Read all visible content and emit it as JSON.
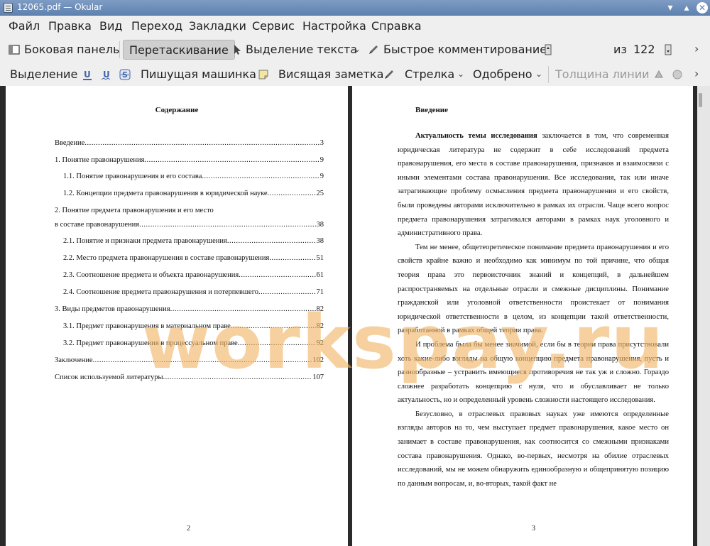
{
  "window": {
    "title": "12065.pdf — Okular"
  },
  "menubar": [
    "Файл",
    "Правка",
    "Вид",
    "Переход",
    "Закладки",
    "Сервис",
    "Настройка",
    "Справка"
  ],
  "toolbar1": {
    "sidebar_label": "Боковая панель",
    "drag_label": "Перетаскивание",
    "text_select_label": "Выделение текста",
    "quick_comment_label": "Быстрое комментирование",
    "page_current": "2",
    "page_of_label": "из",
    "page_total": "122"
  },
  "toolbar2": {
    "selection_label": "Выделение",
    "typewriter_label": "Пишущая машинка",
    "note_label": "Висящая заметка",
    "arrow_label": "Стрелка",
    "stamp_label": "Одобрено",
    "line_width_label": "Толщина линии"
  },
  "left_page": {
    "heading": "Содержание",
    "toc": [
      {
        "label": "Введение",
        "page": "3"
      },
      {
        "label": "1. Понятие правонарушения",
        "page": "9"
      },
      {
        "label": "1.1. Понятие правонарушения и его состава",
        "page": "9"
      },
      {
        "label": "1.2. Концепции предмета правонарушения в юридической науке",
        "page": "25"
      },
      {
        "label": "2. Понятие предмета правонарушения и его место",
        "page": ""
      },
      {
        "label": "в составе правонарушения",
        "page": "38"
      },
      {
        "label": "2.1. Понятие и признаки предмета правонарушения",
        "page": "38"
      },
      {
        "label": "2.2. Место предмета правонарушения в составе правонарушения",
        "page": "51"
      },
      {
        "label": "2.3. Соотношение предмета и объекта правонарушения",
        "page": "61"
      },
      {
        "label": "2.4. Соотношение предмета правонарушения и потерпевшего",
        "page": "71"
      },
      {
        "label": "3. Виды предметов правонарушения",
        "page": "82"
      },
      {
        "label": "3.1. Предмет правонарушения в материальном праве",
        "page": "82"
      },
      {
        "label": "3.2. Предмет правонарушения в процессуальном праве",
        "page": "92"
      },
      {
        "label": "Заключение",
        "page": "102"
      },
      {
        "label": "Список используемой литературы",
        "page": "107"
      }
    ],
    "page_number": "2"
  },
  "right_page": {
    "heading": "Введение",
    "lead_bold": "Актуальность темы исследования",
    "paragraphs": [
      " заключается в том, что современная юридическая литература не содержит в себе исследований предмета правонарушения, его места в составе правонарушения, признаков и взаимосвязи с иными элементами состава правонарушения. Все исследования, так или иначе затрагивающие проблему осмысления предмета правонарушения и его свойств, были проведены авторами исключительно в рамках их отрасли. Чаще всего вопрос предмета правонарушения затрагивался авторами в рамках наук уголовного и административного права.",
      "Тем не менее, общетеоретическое понимание предмета правонарушения и его свойств крайне важно и необходимо как минимум по той причине, что общая теория права это первоисточник знаний и концепций, в дальнейшем распространяемых на отдельные отрасли и смежные дисциплины. Понимание гражданской или уголовной ответственности проистекает от понимания юридической ответственности в целом, из концепции такой ответственности, разработанной в рамках общей теории права.",
      "И проблема была бы менее значимой, если бы в теории права присутствовали хоть какие-либо взгляды на общую концепцию предмета правонарушения, пусть и разнообразные – устранить имеющиеся противоречия не так уж и сложно. Гораздо сложнее разработать концепцию с нуля, что и обуславливает не только актуальность, но и определенный уровень сложности настоящего исследования.",
      "Безусловно, в отраслевых правовых науках уже имеются определенные взгляды авторов на то, чем выступает предмет правонарушения, какое место он занимает в составе правонарушения, как соотносится со смежными признаками состава правонарушения. Однако, во-первых, несмотря на обилие отраслевых исследований, мы не можем обнаружить единообразную и общепринятую позицию по данным вопросам, и, во-вторых, такой факт не"
    ],
    "page_number": "3"
  },
  "watermark": "workspay.ru"
}
